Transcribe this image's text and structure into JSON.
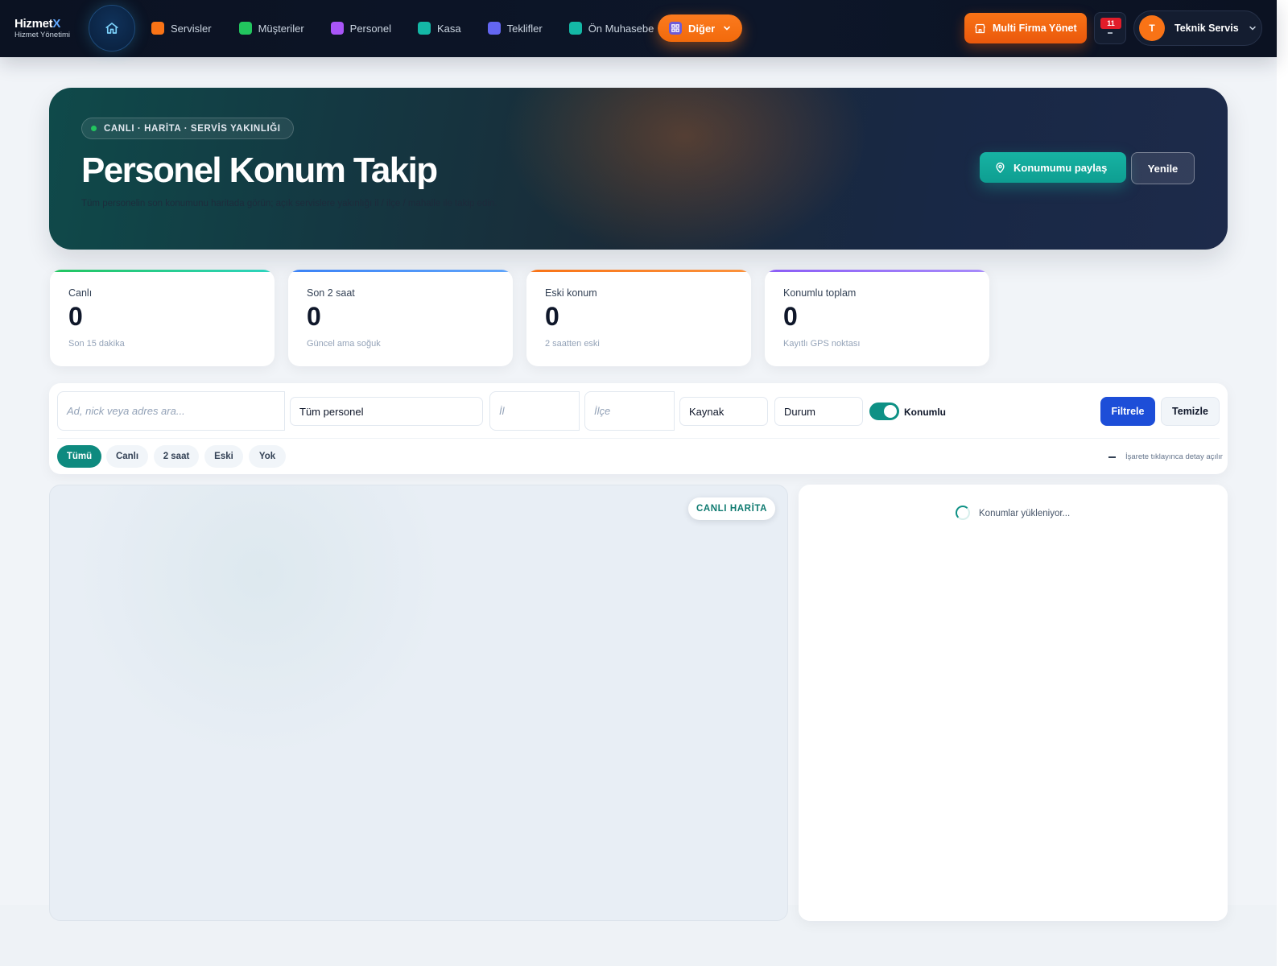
{
  "brand": {
    "name": "Hizmet",
    "name_accent": "X",
    "subtitle": "Hizmet Yönetimi"
  },
  "nav": {
    "items": [
      {
        "label": "Servisler",
        "color": "#f97316"
      },
      {
        "label": "Müşteriler",
        "color": "#22c55e"
      },
      {
        "label": "Personel",
        "color": "#a855f7"
      },
      {
        "label": "Kasa",
        "color": "#14b8a6"
      },
      {
        "label": "Teklifler",
        "color": "#6366f1"
      },
      {
        "label": "Ön Muhasebe",
        "color": "#14b8a6"
      }
    ],
    "more_label": "Diğer"
  },
  "header_actions": {
    "multi_company_label": "Multi Firma Yönet",
    "notification_count": "11",
    "user_initial": "T",
    "user_name": "Teknik Servis"
  },
  "hero": {
    "chip": "CANLI · HARİTA · SERVİS YAKINLIĞI",
    "title": "Personel Konum Takip",
    "subtitle": "Tüm personelin son konumunu haritada görün; açık servislere yakınlığı il / ilçe / mahalle ile takip edin.",
    "share_label": "Konumumu paylaş",
    "refresh_label": "Yenile"
  },
  "stats": [
    {
      "label": "Canlı",
      "value": "0",
      "note": "Son 15 dakika",
      "color": "#22c55e"
    },
    {
      "label": "Son 2 saat",
      "value": "0",
      "note": "Güncel ama soğuk",
      "color": "#3b82f6"
    },
    {
      "label": "Eski konum",
      "value": "0",
      "note": "2 saatten eski",
      "color": "#f97316"
    },
    {
      "label": "Konumlu toplam",
      "value": "0",
      "note": "Kayıtlı GPS noktası",
      "color": "#8b5cf6"
    }
  ],
  "filters": {
    "search_placeholder": "Ad, nick veya adres ara...",
    "personnel_value": "Tüm personel",
    "province_placeholder": "İl",
    "district_placeholder": "İlçe",
    "source_value": "Kaynak",
    "status_value": "Durum",
    "located_toggle_label": "Konumlu",
    "filter_label": "Filtrele",
    "clear_label": "Temizle",
    "chips": [
      "Tümü",
      "Canlı",
      "2 saat",
      "Eski",
      "Yok"
    ],
    "hint": "İşarete tıklayınca detay açılır"
  },
  "map": {
    "badge": "CANLI HARİTA"
  },
  "list": {
    "loading_text": "Konumlar yükleniyor..."
  }
}
